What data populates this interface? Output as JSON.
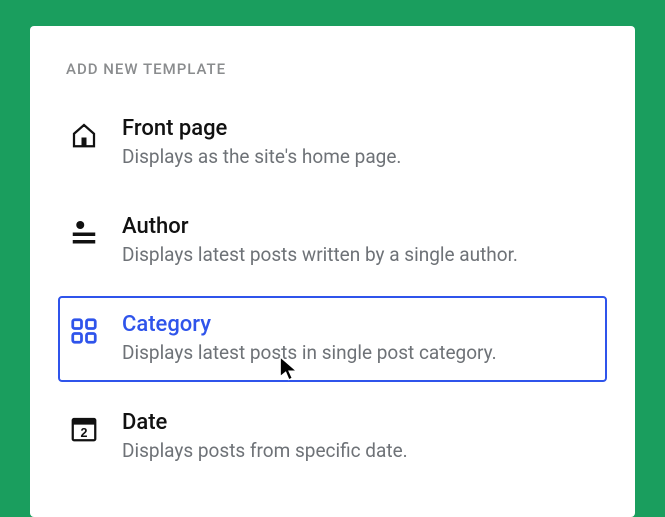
{
  "heading": "ADD NEW TEMPLATE",
  "items": [
    {
      "title": "Front page",
      "desc": "Displays as the site's home page."
    },
    {
      "title": "Author",
      "desc": "Displays latest posts written by a single author."
    },
    {
      "title": "Category",
      "desc": "Displays latest posts in single post category."
    },
    {
      "title": "Date",
      "desc": "Displays posts from specific date."
    }
  ]
}
